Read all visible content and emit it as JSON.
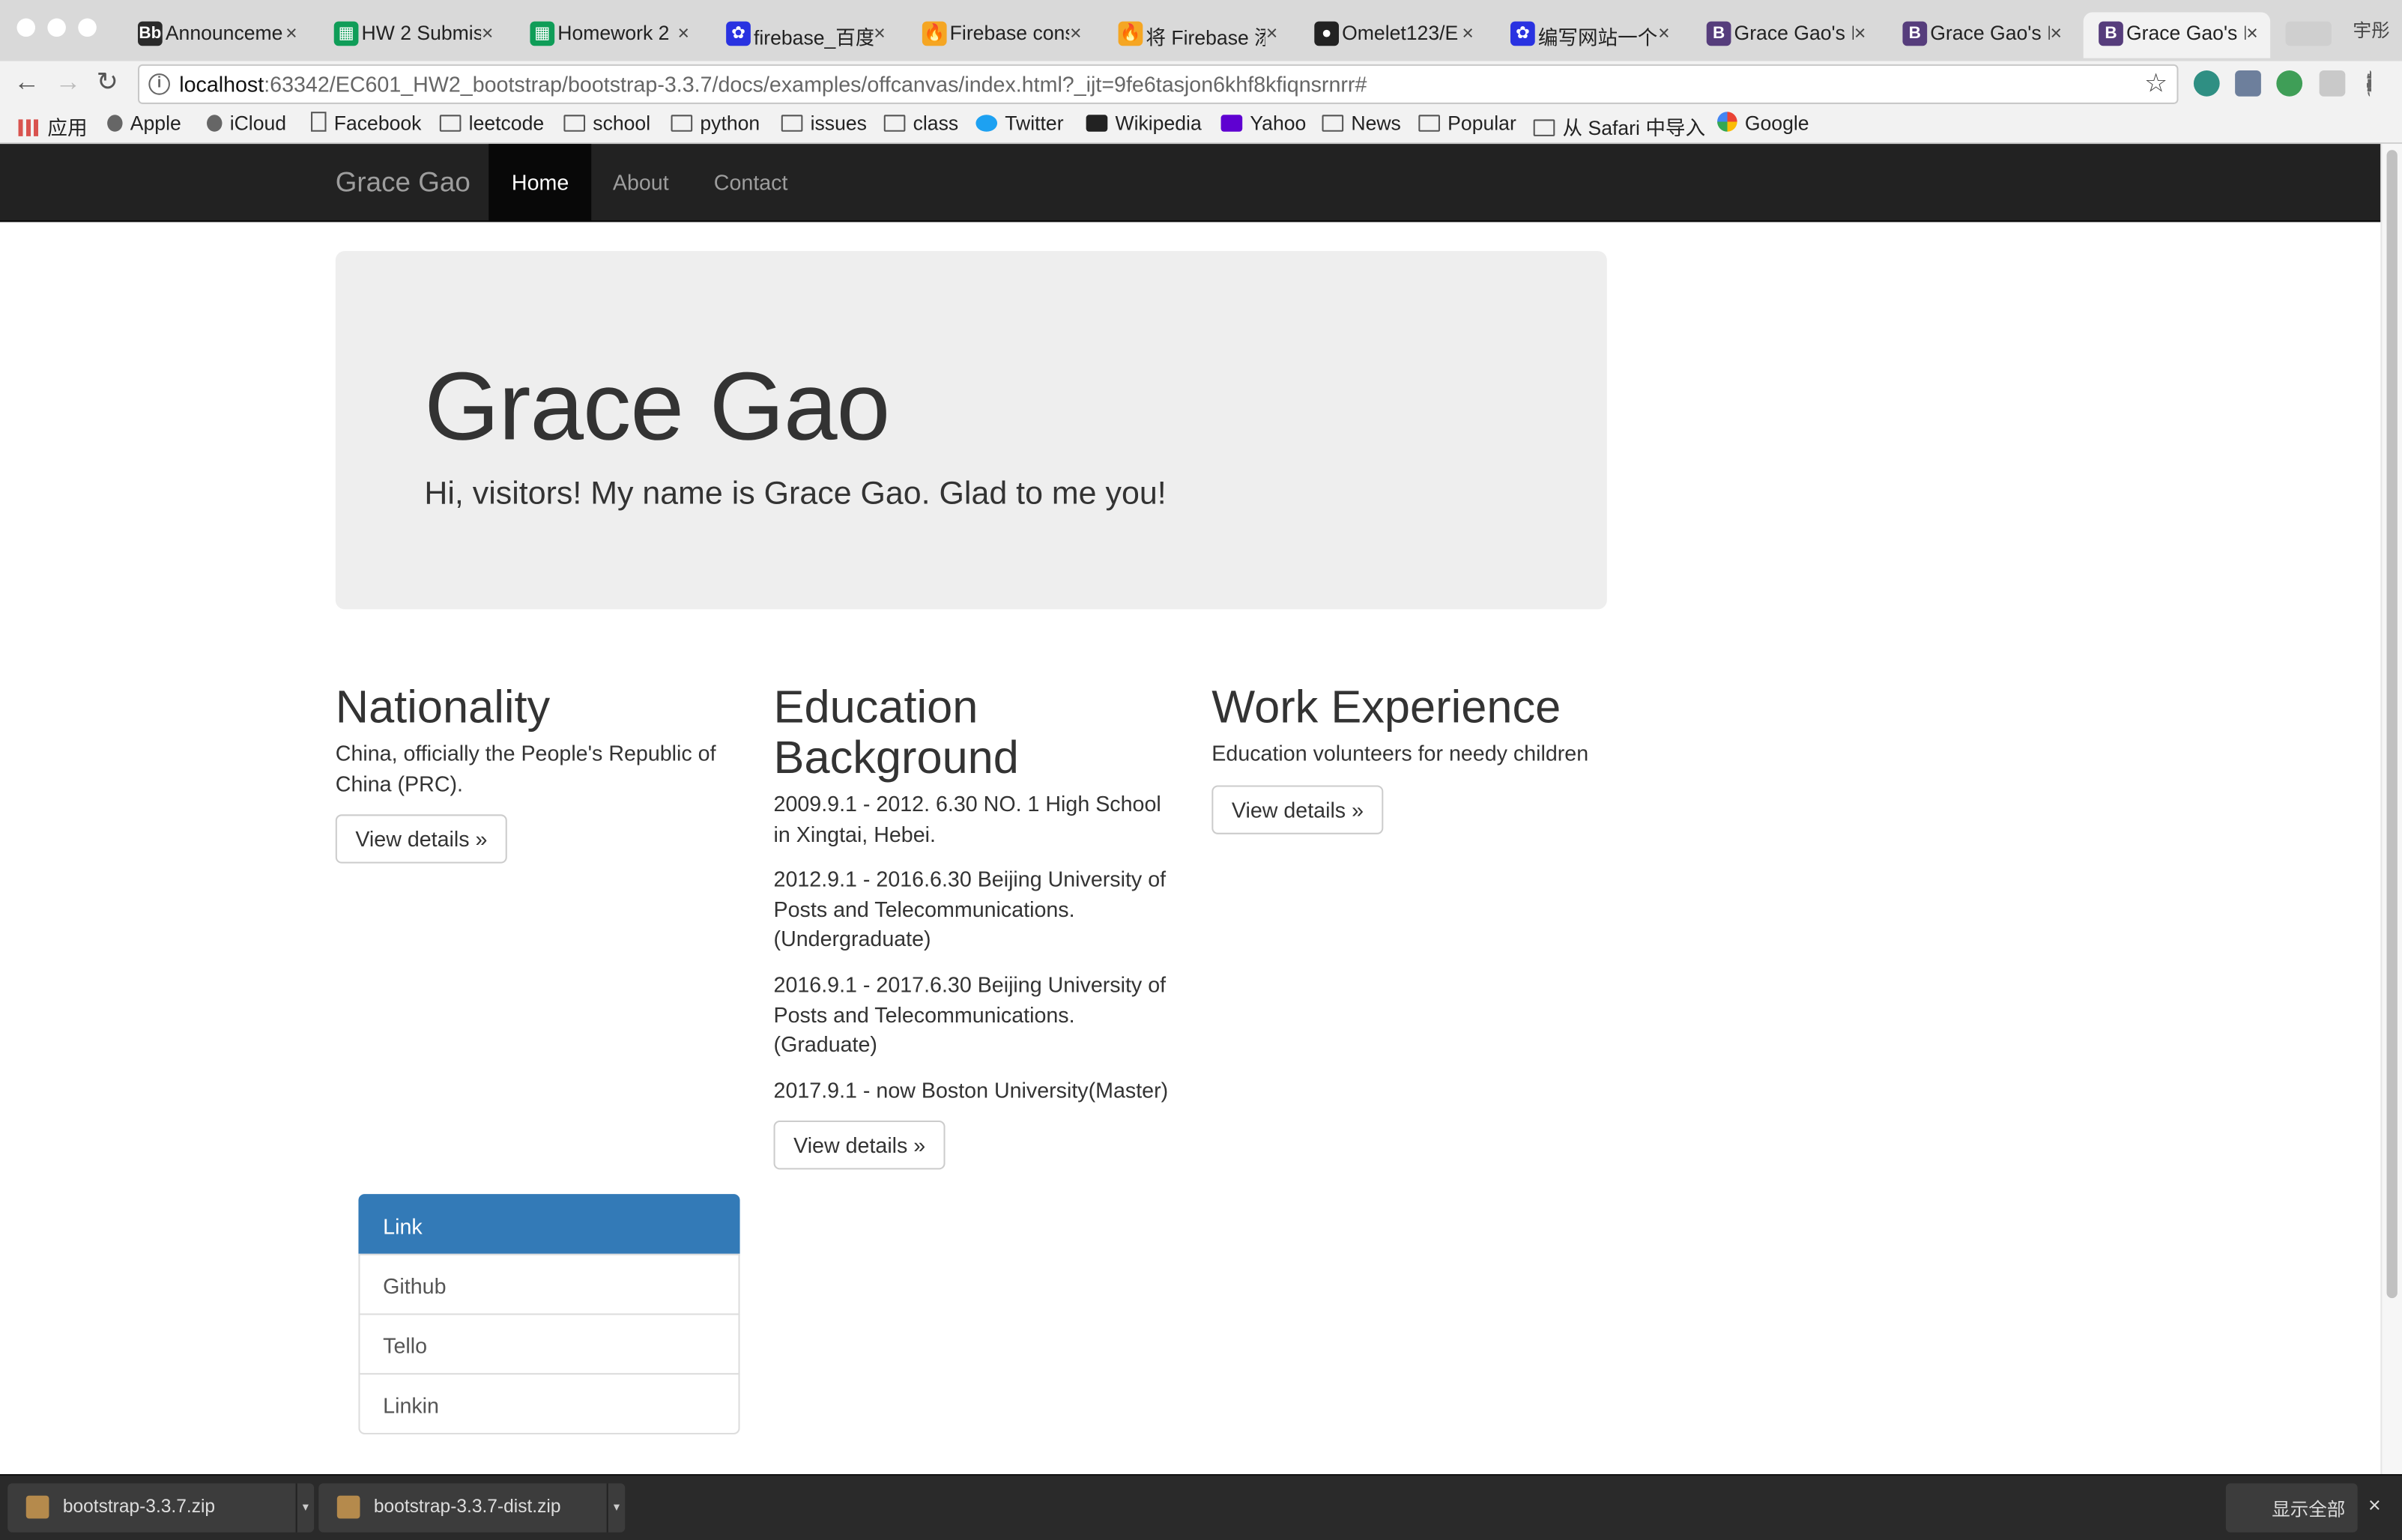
{
  "browser": {
    "tabs": [
      {
        "label": "Announceme",
        "icon_text": "Bb",
        "icon_color": "#2a2a2a"
      },
      {
        "label": "HW 2 Submis",
        "icon_text": "▦",
        "icon_color": "#0f9d58"
      },
      {
        "label": "Homework 2",
        "icon_text": "▦",
        "icon_color": "#0f9d58"
      },
      {
        "label": "firebase_百度",
        "icon_text": "✿",
        "icon_color": "#2932e1"
      },
      {
        "label": "Firebase cons",
        "icon_text": "🔥",
        "icon_color": "#f5a623"
      },
      {
        "label": "将 Firebase 添",
        "icon_text": "🔥",
        "icon_color": "#f5a623"
      },
      {
        "label": "Omelet123/E",
        "icon_text": "●",
        "icon_color": "#222222"
      },
      {
        "label": "编写网站一个",
        "icon_text": "✿",
        "icon_color": "#2932e1"
      },
      {
        "label": "Grace Gao's I",
        "icon_text": "B",
        "icon_color": "#563d7c"
      },
      {
        "label": "Grace Gao's I",
        "icon_text": "B",
        "icon_color": "#563d7c"
      },
      {
        "label": "Grace Gao's I",
        "icon_text": "B",
        "icon_color": "#563d7c"
      }
    ],
    "tab_close_glyph": "×",
    "user_label": "宇彤",
    "url_host": "localhost",
    "url_rest": ":63342/EC601_HW2_bootstrap/bootstrap-3.3.7/docs/examples/offcanvas/index.html?_ijt=9fe6tasjon6khf8kfiqnsrnrr#",
    "info_glyph": "i",
    "star_glyph": "☆",
    "back_glyph": "←",
    "forward_glyph": "→",
    "reload_glyph": "↻",
    "bookmarks": [
      {
        "label": "应用",
        "icon": "apps-icon"
      },
      {
        "label": "Apple",
        "icon": "apple-icon"
      },
      {
        "label": "iCloud",
        "icon": "apple-icon"
      },
      {
        "label": "Facebook",
        "icon": "page-icon"
      },
      {
        "label": "leetcode",
        "icon": "folder-icon"
      },
      {
        "label": "school",
        "icon": "folder-icon"
      },
      {
        "label": "python",
        "icon": "folder-icon"
      },
      {
        "label": "issues",
        "icon": "folder-icon"
      },
      {
        "label": "class",
        "icon": "folder-icon"
      },
      {
        "label": "Twitter",
        "icon": "twitter-icon"
      },
      {
        "label": "Wikipedia",
        "icon": "wikipedia-icon"
      },
      {
        "label": "Yahoo",
        "icon": "yahoo-icon"
      },
      {
        "label": "News",
        "icon": "folder-icon"
      },
      {
        "label": "Popular",
        "icon": "folder-icon"
      },
      {
        "label": "从 Safari 中导入",
        "icon": "folder-icon"
      },
      {
        "label": "Google",
        "icon": "google-icon"
      }
    ]
  },
  "page": {
    "brand": "Grace Gao",
    "nav": [
      {
        "label": "Home",
        "active": true
      },
      {
        "label": "About",
        "active": false
      },
      {
        "label": "Contact",
        "active": false
      }
    ],
    "jumbotron": {
      "title": "Grace Gao",
      "subtitle": "Hi, visitors! My name is Grace Gao. Glad to me you!"
    },
    "columns": [
      {
        "heading": "Nationality",
        "paragraphs": [
          "China, officially the People's Republic of China (PRC)."
        ],
        "button": "View details »"
      },
      {
        "heading": "Education Background",
        "paragraphs": [
          "2009.9.1 - 2012. 6.30 NO. 1 High School in Xingtai, Hebei.",
          "2012.9.1 - 2016.6.30 Beijing University of Posts and Telecommunications.(Undergraduate)",
          "2016.9.1 - 2017.6.30 Beijing University of Posts and Telecommunications.(Graduate)",
          "2017.9.1 - now Boston University(Master)"
        ],
        "button": "View details »"
      },
      {
        "heading": "Work Experience",
        "paragraphs": [
          "Education volunteers for needy children"
        ],
        "button": "View details »"
      }
    ],
    "sidebar_links": [
      {
        "label": "Link",
        "active": true
      },
      {
        "label": "Github",
        "active": false
      },
      {
        "label": "Tello",
        "active": false
      },
      {
        "label": "Linkin",
        "active": false
      }
    ]
  },
  "downloads": {
    "items": [
      {
        "label": "bootstrap-3.3.7.zip"
      },
      {
        "label": "bootstrap-3.3.7-dist.zip"
      }
    ],
    "caret_glyph": "▾",
    "show_all": "显示全部",
    "close_glyph": "×"
  },
  "colors": {
    "navbar_bg": "#222222",
    "jumbotron_bg": "#eeeeee",
    "list_active": "#337ab7"
  }
}
